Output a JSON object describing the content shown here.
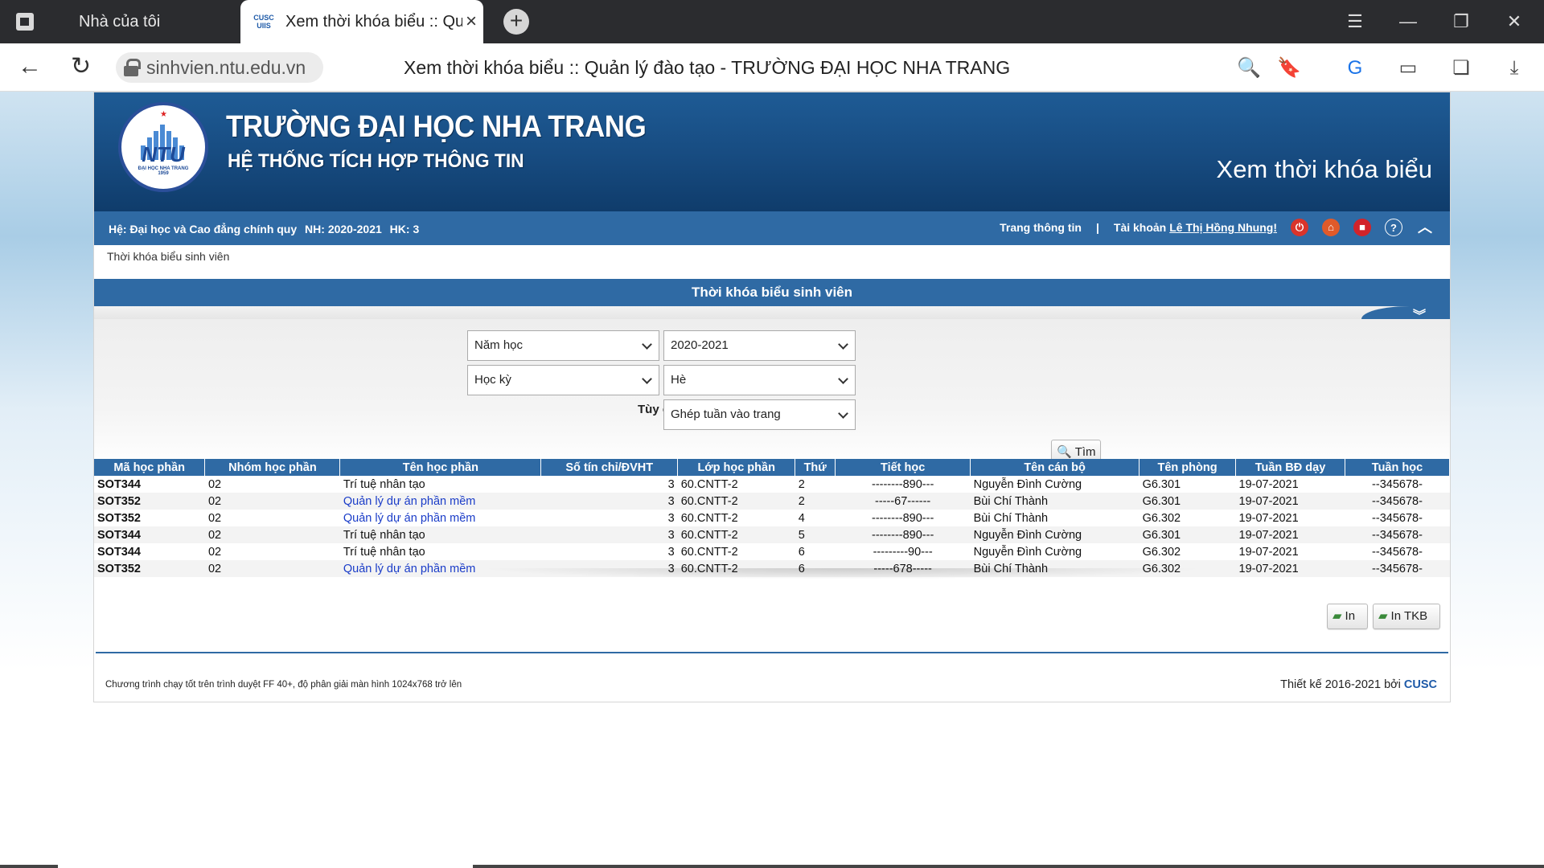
{
  "browser": {
    "tabs": [
      {
        "label": "Nhà của tôi"
      },
      {
        "label": "Xem thời khóa biểu :: Quản lý đào tạo - TRƯỜNG ĐẠI HỌC NHA TRANG",
        "favicon_text": "CUSC UIIS"
      }
    ],
    "url": "sinhvien.ntu.edu.vn",
    "page_title": "Xem thời khóa biểu :: Quản lý đào tạo - TRƯỜNG ĐẠI HỌC NHA TRANG"
  },
  "header": {
    "logo": {
      "ntu": "NTU",
      "sub": "ĐẠI HỌC NHA TRANG",
      "year": "1959"
    },
    "university": "TRƯỜNG ĐẠI HỌC NHA TRANG",
    "system": "HỆ THỐNG TÍCH HỢP THÔNG TIN",
    "page_heading": "Xem thời khóa biểu"
  },
  "infobar": {
    "he": "Hệ: Đại học và Cao đẳng chính quy",
    "nh": "NH: 2020-2021",
    "hk": "HK: 3",
    "trang_thong_tin": "Trang thông tin",
    "sep": "|",
    "tai_khoan": "Tài khoản",
    "user": "Lê Thị Hồng Nhung!",
    "icons": [
      "power-icon",
      "home-icon",
      "video-icon",
      "help-icon",
      "collapse-up-icon"
    ]
  },
  "breadcrumb": "Thời khóa biểu sinh viên",
  "section_title": "Thời khóa biểu sinh viên",
  "filters": {
    "type1": "Năm học",
    "value1": "2020-2021",
    "type2": "Học kỳ",
    "value2": "Hè",
    "option_label": "Tùy chọn",
    "option_value": "Ghép tuần vào trang",
    "search_button": "Tìm"
  },
  "table": {
    "headers": [
      "Mã học phần",
      "Nhóm học phần",
      "Tên học phần",
      "Số tín chỉ/ĐVHT",
      "Lớp học phần",
      "Thứ",
      "Tiết học",
      "Tên cán bộ",
      "Tên phòng",
      "Tuần BĐ dạy",
      "Tuần học"
    ],
    "rows": [
      [
        "SOT344",
        "02",
        "Trí tuệ nhân tạo",
        "3",
        "60.CNTT-2",
        "2",
        "--------890---",
        "Nguyễn Đình Cường",
        "G6.301",
        "19-07-2021",
        "--345678-"
      ],
      [
        "SOT352",
        "02",
        "Quản lý dự án phần mềm",
        "3",
        "60.CNTT-2",
        "2",
        "-----67------",
        "Bùi Chí Thành",
        "G6.301",
        "19-07-2021",
        "--345678-"
      ],
      [
        "SOT352",
        "02",
        "Quản lý dự án phần mềm",
        "3",
        "60.CNTT-2",
        "4",
        "--------890---",
        "Bùi Chí Thành",
        "G6.302",
        "19-07-2021",
        "--345678-"
      ],
      [
        "SOT344",
        "02",
        "Trí tuệ nhân tạo",
        "3",
        "60.CNTT-2",
        "5",
        "--------890---",
        "Nguyễn Đình Cường",
        "G6.301",
        "19-07-2021",
        "--345678-"
      ],
      [
        "SOT344",
        "02",
        "Trí tuệ nhân tạo",
        "3",
        "60.CNTT-2",
        "6",
        "---------90---",
        "Nguyễn Đình Cường",
        "G6.302",
        "19-07-2021",
        "--345678-"
      ],
      [
        "SOT352",
        "02",
        "Quản lý dự án phần mềm",
        "3",
        "60.CNTT-2",
        "6",
        "-----678-----",
        "Bùi Chí Thành",
        "G6.302",
        "19-07-2021",
        "--345678-"
      ]
    ]
  },
  "print_buttons": {
    "print": "In",
    "print_tkb": "In TKB"
  },
  "footer": {
    "left": "Chương trình chạy tốt trên trình duyệt FF 40+, độ phân giải màn hình 1024x768 trở lên",
    "right_prefix": "Thiết kế 2016-2021 bởi",
    "right_brand": "CUSC"
  },
  "colors": {
    "brand_blue": "#2f6aa4",
    "header_blue": "#174b80",
    "link_blue": "#1a3cc8"
  }
}
